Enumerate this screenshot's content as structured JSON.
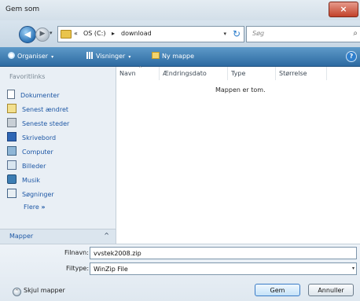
{
  "window": {
    "title": "Gem som",
    "close_glyph": "×"
  },
  "address_bar": {
    "back_glyph": "◀",
    "forward_glyph": "▶",
    "path_prefix": "«",
    "segments": [
      "OS (C:)",
      "download"
    ],
    "separator": "▸",
    "dropdown_glyph": "▾",
    "refresh_glyph": "↻"
  },
  "search": {
    "placeholder": "Søg",
    "icon": "search-icon",
    "glyph": "⌕"
  },
  "toolbar": {
    "organise_label": "Organiser",
    "views_label": "Visninger",
    "new_folder_label": "Ny mappe",
    "caret_glyph": "▾",
    "help_glyph": "?"
  },
  "nav_pane": {
    "heading": "Favoritlinks",
    "links": [
      {
        "label": "Dokumenter",
        "icon": "documents-icon"
      },
      {
        "label": "Senest ændret",
        "icon": "recently-changed-icon"
      },
      {
        "label": "Seneste steder",
        "icon": "recent-places-icon"
      },
      {
        "label": "Skrivebord",
        "icon": "desktop-icon"
      },
      {
        "label": "Computer",
        "icon": "computer-icon"
      },
      {
        "label": "Billeder",
        "icon": "pictures-icon"
      },
      {
        "label": "Musik",
        "icon": "music-icon"
      },
      {
        "label": "Søgninger",
        "icon": "searches-icon"
      }
    ],
    "more_label": "Flere",
    "more_glyph": "»",
    "folders_label": "Mapper",
    "folders_caret": "^"
  },
  "file_list": {
    "columns": [
      "Navn",
      "Ændringsdato",
      "Type",
      "Størrelse"
    ],
    "sort_glyph": "^",
    "empty_message": "Mappen er tom."
  },
  "form": {
    "filename_label": "Filnavn:",
    "filename_value": "vvstek2008.zip",
    "filetype_label": "Filtype:",
    "filetype_value": "WinZip File",
    "dropdown_glyph": "▾"
  },
  "footer": {
    "hide_folders_label": "Skjul mapper",
    "hide_glyph": "^",
    "save_label": "Gem",
    "cancel_label": "Annuller"
  }
}
